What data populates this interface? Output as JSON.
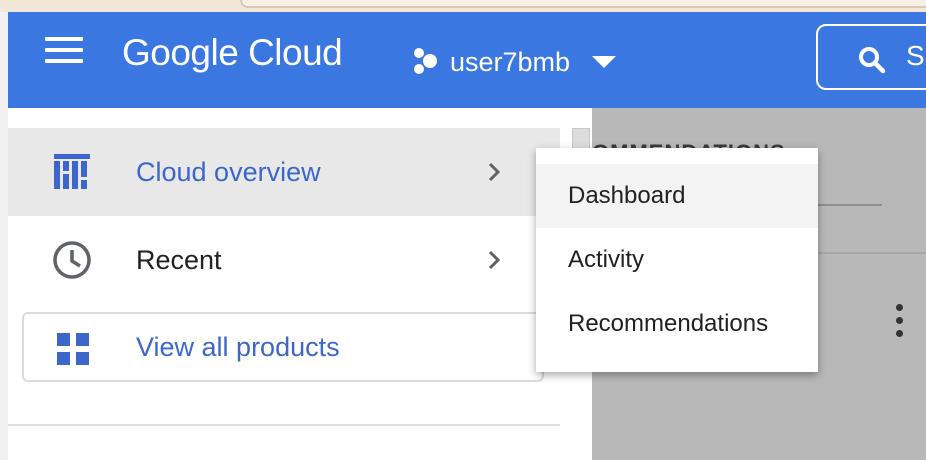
{
  "header": {
    "logo_text": "Google Cloud",
    "project_name": "user7bmb",
    "search_text": "S",
    "colors": {
      "bar": "#3b77e0",
      "accent": "#3c66c9"
    }
  },
  "sidebar": {
    "items": [
      {
        "label": "Cloud overview",
        "icon": "dashboard-icon",
        "active": true
      },
      {
        "label": "Recent",
        "icon": "clock-icon",
        "active": false
      }
    ],
    "all_products_label": "View all products"
  },
  "background": {
    "tab_label": "OMMENDATIONS"
  },
  "flyout": {
    "items": [
      {
        "label": "Dashboard",
        "hover": true
      },
      {
        "label": "Activity",
        "hover": false
      },
      {
        "label": "Recommendations",
        "hover": false
      }
    ]
  }
}
